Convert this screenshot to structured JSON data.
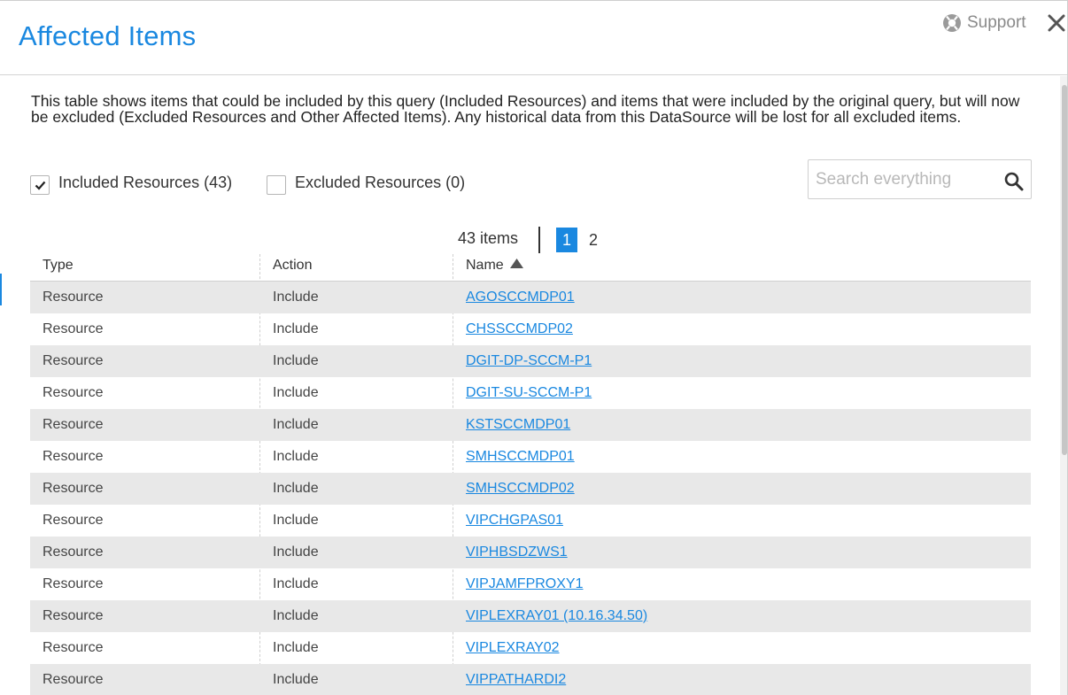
{
  "dialog": {
    "title": "Affected Items",
    "support_label": "Support"
  },
  "description": "This table shows items that could be included by this query (Included Resources) and items that were included by the original query, but will now be excluded (Excluded Resources and Other Affected Items). Any historical data from this DataSource will be lost for all excluded items.",
  "filters": {
    "included": {
      "label": "Included Resources (43)",
      "checked": true
    },
    "excluded": {
      "label": "Excluded Resources (0)",
      "checked": false
    }
  },
  "search": {
    "placeholder": "Search everything",
    "value": ""
  },
  "pagination": {
    "count_label": "43 items",
    "pages": [
      "1",
      "2"
    ],
    "current_page": "1"
  },
  "table": {
    "columns": [
      "Type",
      "Action",
      "Name"
    ],
    "sort": {
      "column": "Name",
      "direction": "ascending"
    },
    "rows": [
      {
        "type": "Resource",
        "action": "Include",
        "name": "AGOSCCMDP01"
      },
      {
        "type": "Resource",
        "action": "Include",
        "name": "CHSSCCMDP02"
      },
      {
        "type": "Resource",
        "action": "Include",
        "name": "DGIT-DP-SCCM-P1"
      },
      {
        "type": "Resource",
        "action": "Include",
        "name": "DGIT-SU-SCCM-P1"
      },
      {
        "type": "Resource",
        "action": "Include",
        "name": "KSTSCCMDP01"
      },
      {
        "type": "Resource",
        "action": "Include",
        "name": "SMHSCCMDP01"
      },
      {
        "type": "Resource",
        "action": "Include",
        "name": "SMHSCCMDP02"
      },
      {
        "type": "Resource",
        "action": "Include",
        "name": "VIPCHGPAS01"
      },
      {
        "type": "Resource",
        "action": "Include",
        "name": "VIPHBSDZWS1"
      },
      {
        "type": "Resource",
        "action": "Include",
        "name": "VIPJAMFPROXY1"
      },
      {
        "type": "Resource",
        "action": "Include",
        "name": "VIPLEXRAY01 (10.16.34.50)"
      },
      {
        "type": "Resource",
        "action": "Include",
        "name": "VIPLEXRAY02"
      },
      {
        "type": "Resource",
        "action": "Include",
        "name": "VIPPATHARDI2"
      }
    ]
  },
  "colors": {
    "accent": "#1a88e0",
    "row_stripe": "#e8e8e8",
    "text": "#333333"
  },
  "icons": {
    "support": "lifebuoy-icon",
    "close": "close-icon",
    "search": "search-icon",
    "sort": "sort-ascending-icon",
    "check": "checkmark-icon"
  }
}
